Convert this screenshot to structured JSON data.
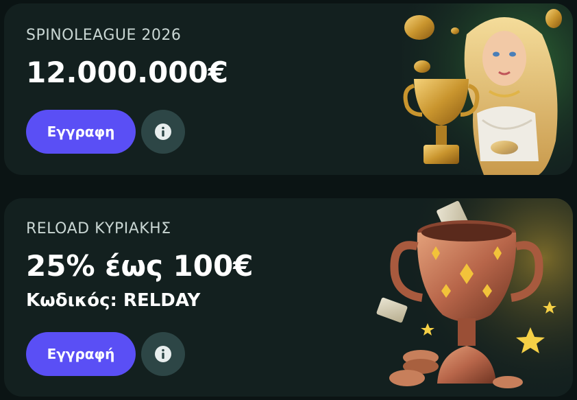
{
  "promos": [
    {
      "title": "SPINOLEAGUE 2026",
      "amount": "12.000.000€",
      "button_label": "Εγγραφη",
      "info_icon": "info-icon",
      "art": "goddess-with-golden-trophy-illustration"
    },
    {
      "title": "RELOAD ΚΥΡΙΑΚΗΣ",
      "amount": "25% έως 100€",
      "code_line": "Κωδικός: RELDAY",
      "button_label": "Εγγραφή",
      "info_icon": "info-icon",
      "art": "bronze-trophy-with-coins-illustration"
    }
  ],
  "colors": {
    "page_bg": "#0b1414",
    "card_bg": "#13201f",
    "button_bg": "#5a4ff5",
    "info_bg": "#2d4646",
    "title_text": "#c9d6d3"
  }
}
